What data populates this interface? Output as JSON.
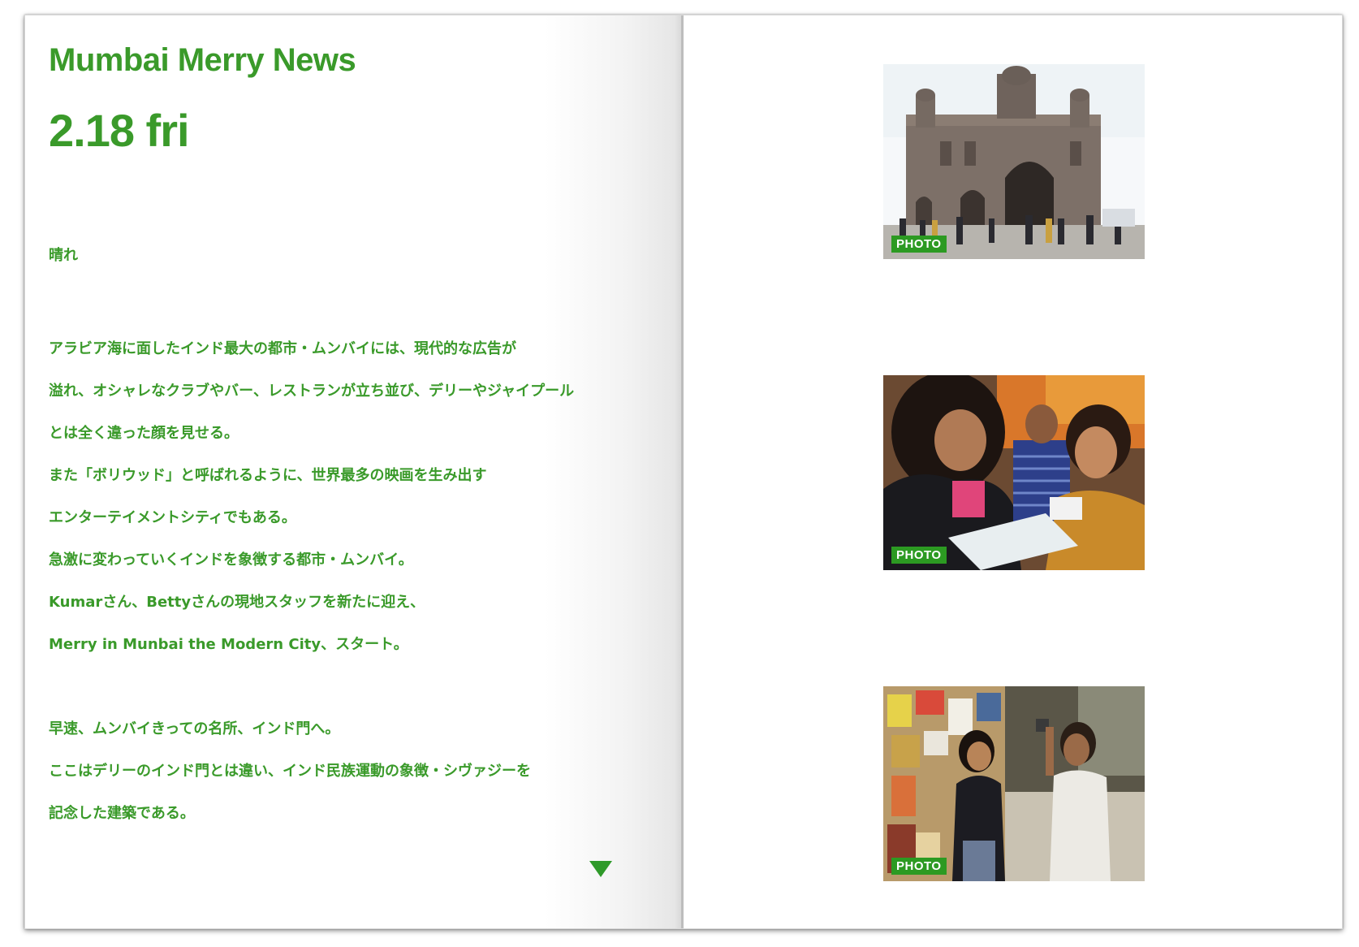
{
  "header": {
    "title": "Mumbai Merry News",
    "date": "2.18 fri"
  },
  "weather": "晴れ",
  "body_lines": [
    "アラビア海に面したインド最大の都市・ムンバイには、現代的な広告が",
    "溢れ、オシャレなクラブやバー、レストランが立ち並び、デリーやジャイプール",
    "とは全く違った顔を見せる。",
    "また「ボリウッド」と呼ばれるように、世界最多の映画を生み出す",
    "エンターテイメントシティでもある。",
    "急激に変わっていくインドを象徴する都市・ムンバイ。",
    "Kumarさん、Bettyさんの現地スタッフを新たに迎え、",
    "Merry in Munbai the Modern City、スタート。",
    "",
    "早速、ムンバイきっての名所、インド門へ。",
    "ここはデリーのインド門とは違い、インド民族運動の象徴・シヴァジーを",
    "記念した建築である。"
  ],
  "photos": [
    {
      "badge": "PHOTO",
      "subject": "gateway-of-india"
    },
    {
      "badge": "PHOTO",
      "subject": "women-writing"
    },
    {
      "badge": "PHOTO",
      "subject": "street-interview"
    }
  ],
  "colors": {
    "accent_green": "#3a9a2a",
    "badge_green": "#2c9a22"
  }
}
